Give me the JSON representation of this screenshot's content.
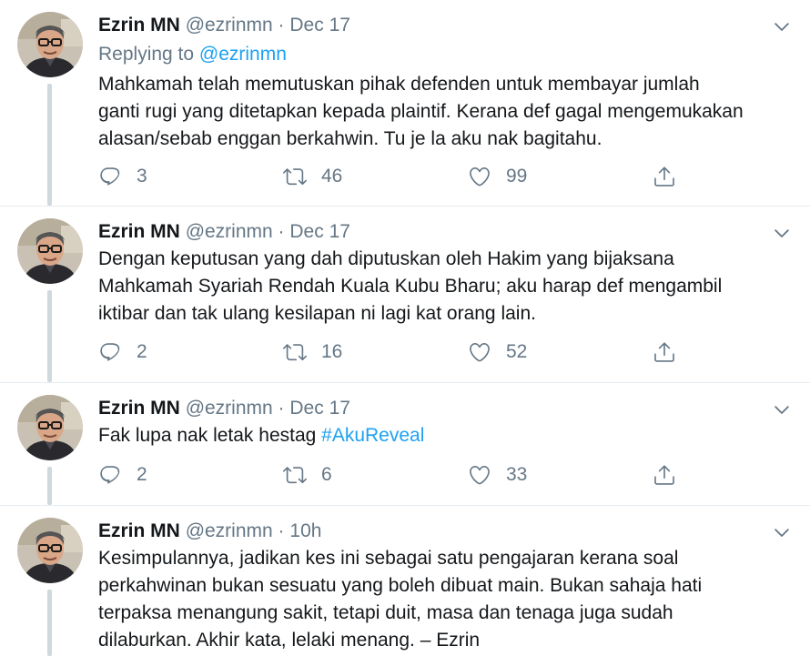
{
  "tweets": [
    {
      "name": "Ezrin MN",
      "handle": "@ezrinmn",
      "separator": "·",
      "time": "Dec 17",
      "replying_prefix": "Replying to ",
      "replying_handle": "@ezrinmn",
      "text_lines": [
        "Mahkamah telah memutuskan pihak defenden untuk membayar jumlah",
        "ganti rugi yang ditetapkan kepada plaintif. Kerana def gagal mengemukakan",
        "alasan/sebab enggan berkahwin. Tu je la aku nak bagitahu."
      ],
      "replies": "3",
      "retweets": "46",
      "likes": "99"
    },
    {
      "name": "Ezrin MN",
      "handle": "@ezrinmn",
      "separator": "·",
      "time": "Dec 17",
      "text_lines": [
        "Dengan keputusan yang dah diputuskan oleh Hakim yang bijaksana",
        "Mahkamah Syariah Rendah Kuala Kubu Bharu; aku harap def mengambil",
        "iktibar dan tak ulang kesilapan ni lagi kat orang lain."
      ],
      "replies": "2",
      "retweets": "16",
      "likes": "52"
    },
    {
      "name": "Ezrin MN",
      "handle": "@ezrinmn",
      "separator": "·",
      "time": "Dec 17",
      "text_prefix": "Fak lupa nak letak hestag ",
      "hashtag": "#AkuReveal",
      "replies": "2",
      "retweets": "6",
      "likes": "33"
    },
    {
      "name": "Ezrin MN",
      "handle": "@ezrinmn",
      "separator": "·",
      "time": "10h",
      "text_lines": [
        "Kesimpulannya, jadikan kes ini sebagai satu pengajaran kerana soal",
        "perkahwinan bukan sesuatu yang boleh dibuat main. Bukan sahaja hati",
        "terpaksa menangung sakit, tetapi duit, masa dan tenaga juga sudah",
        "dilaburkan. Akhir kata, lelaki menang. – Ezrin"
      ]
    }
  ],
  "icons": {
    "reply": "reply-icon",
    "retweet": "retweet-icon",
    "like": "heart-icon",
    "share": "share-icon",
    "caret": "chevron-down-icon"
  },
  "colors": {
    "text": "#14171a",
    "muted": "#657786",
    "link": "#1da1f2",
    "thread_line": "#cfd9de",
    "divider": "#e6ecf0"
  }
}
